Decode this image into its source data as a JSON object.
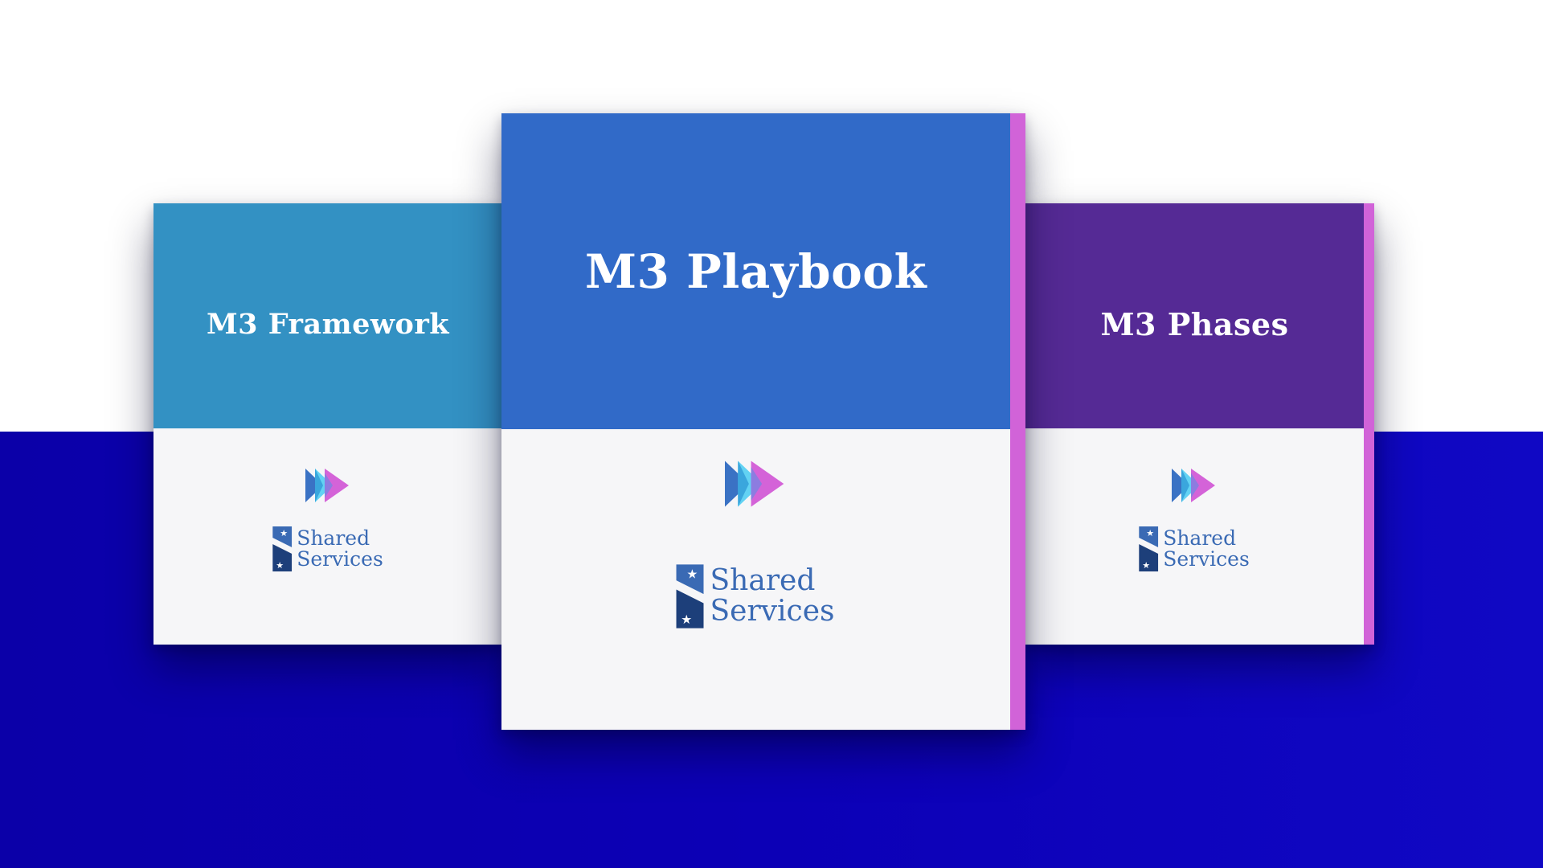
{
  "cards": [
    {
      "id": "left",
      "title": "M3 Framework",
      "top_color": "#3391c3",
      "logo_line1": "Shared",
      "logo_line2": "Services"
    },
    {
      "id": "center",
      "title": "M3 Playbook",
      "top_color": "#316ac8",
      "spine_color": "#d163d8",
      "logo_line1": "Shared",
      "logo_line2": "Services"
    },
    {
      "id": "right",
      "title": "M3 Phases",
      "top_color": "#552a95",
      "spine_color": "#d163d8",
      "logo_line1": "Shared",
      "logo_line2": "Services"
    }
  ],
  "icons": {
    "arrows": "triple-play-arrows-icon",
    "logo": "shared-services-logo-icon"
  },
  "colors": {
    "background_top": "#ffffff",
    "background_bottom": "#0c00b6",
    "arrow_blue": "#3a72c4",
    "arrow_cyan": "#5ad0f2",
    "arrow_pink": "#d25bd6",
    "logo_blue": "#3a6ab4",
    "logo_dark": "#1d3f7a"
  }
}
